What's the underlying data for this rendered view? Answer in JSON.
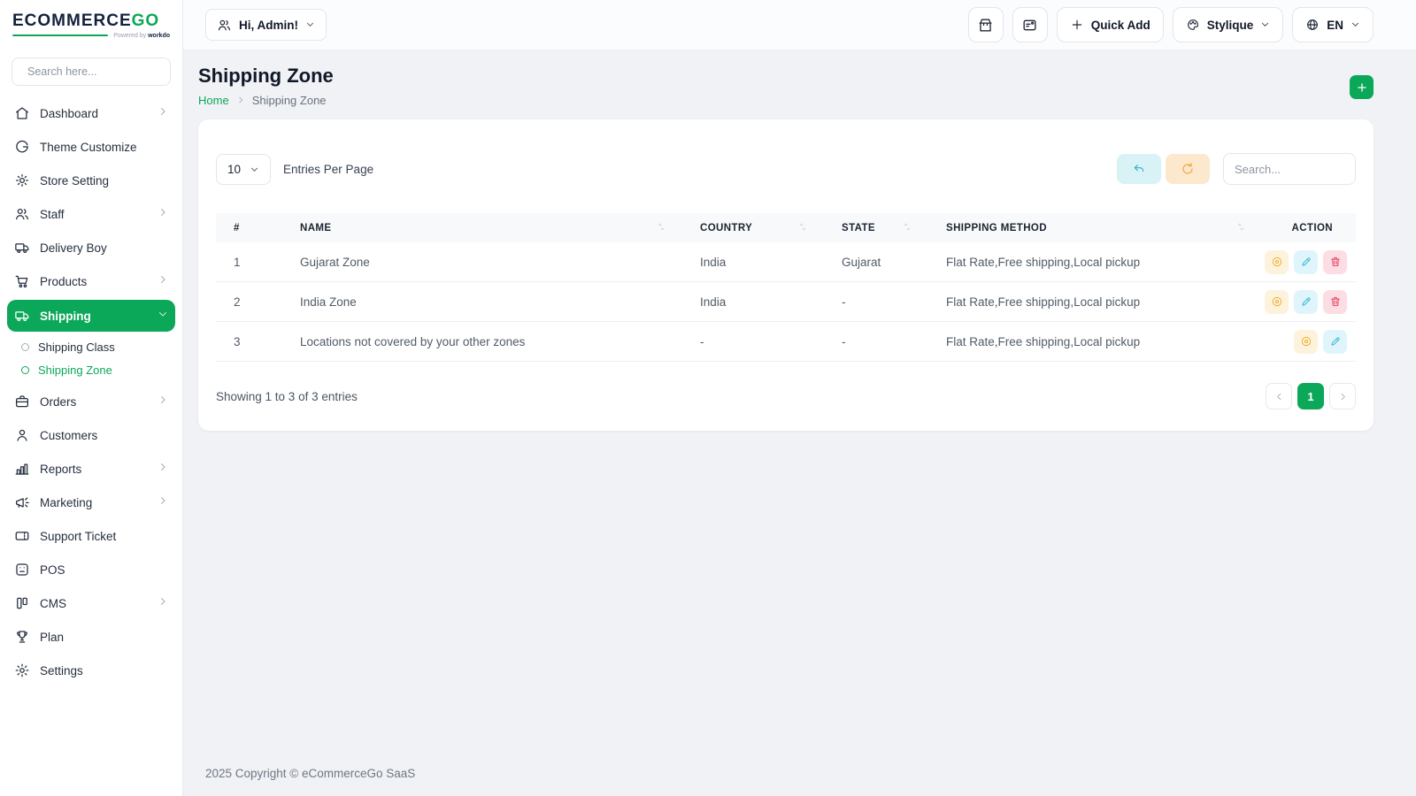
{
  "brand": {
    "name_primary": "ECOMMERCE",
    "name_accent": "GO",
    "powered_by": "Powered by",
    "powered_brand": "workdo"
  },
  "sidebar": {
    "search_placeholder": "Search here...",
    "items": [
      {
        "label": "Dashboard",
        "icon": "home-icon"
      },
      {
        "label": "Theme Customize",
        "icon": "theme-icon"
      },
      {
        "label": "Store Setting",
        "icon": "store-gear-icon"
      },
      {
        "label": "Staff",
        "icon": "users-icon"
      },
      {
        "label": "Delivery Boy",
        "icon": "truck-icon"
      },
      {
        "label": "Products",
        "icon": "cart-icon"
      },
      {
        "label": "Shipping",
        "icon": "shipping-truck-icon",
        "active": true
      },
      {
        "label": "Orders",
        "icon": "briefcase-icon"
      },
      {
        "label": "Customers",
        "icon": "user-icon"
      },
      {
        "label": "Reports",
        "icon": "bar-chart-icon"
      },
      {
        "label": "Marketing",
        "icon": "megaphone-icon"
      },
      {
        "label": "Support Ticket",
        "icon": "ticket-icon"
      },
      {
        "label": "POS",
        "icon": "pos-icon"
      },
      {
        "label": "CMS",
        "icon": "cms-icon"
      },
      {
        "label": "Plan",
        "icon": "trophy-icon"
      },
      {
        "label": "Settings",
        "icon": "gear-icon"
      }
    ],
    "shipping_children": [
      {
        "label": "Shipping Class"
      },
      {
        "label": "Shipping Zone",
        "active": true
      }
    ]
  },
  "topbar": {
    "greeting": "Hi, Admin!",
    "quick_add": "Quick Add",
    "theme_name": "Stylique",
    "language": "EN"
  },
  "page": {
    "title": "Shipping Zone",
    "breadcrumb": {
      "home": "Home",
      "current": "Shipping Zone"
    }
  },
  "table_card": {
    "entries_select": "10",
    "entries_label": "Entries Per Page",
    "search_placeholder": "Search...",
    "columns": [
      "#",
      "NAME",
      "COUNTRY",
      "STATE",
      "SHIPPING METHOD",
      "ACTION"
    ],
    "rows": [
      {
        "num": "1",
        "name": "Gujarat Zone",
        "country": "India",
        "state": "Gujarat",
        "method": "Flat Rate,Free shipping,Local pickup"
      },
      {
        "num": "2",
        "name": "India Zone",
        "country": "India",
        "state": "-",
        "method": "Flat Rate,Free shipping,Local pickup"
      },
      {
        "num": "3",
        "name": "Locations not covered by your other zones",
        "country": "-",
        "state": "-",
        "method": "Flat Rate,Free shipping,Local pickup"
      }
    ],
    "summary": "Showing 1 to 3 of 3 entries",
    "pagination": {
      "current": "1"
    }
  },
  "footer": {
    "copyright": "2025 Copyright © eCommerceGo SaaS"
  },
  "colors": {
    "primary_green": "#0ca859",
    "navy": "#14213d",
    "view_accent": "#f0ad2d",
    "edit_accent": "#33b8d8",
    "delete_accent": "#e4435f",
    "undo_accent": "#2cb4cb",
    "refresh_accent": "#f2a33c"
  }
}
